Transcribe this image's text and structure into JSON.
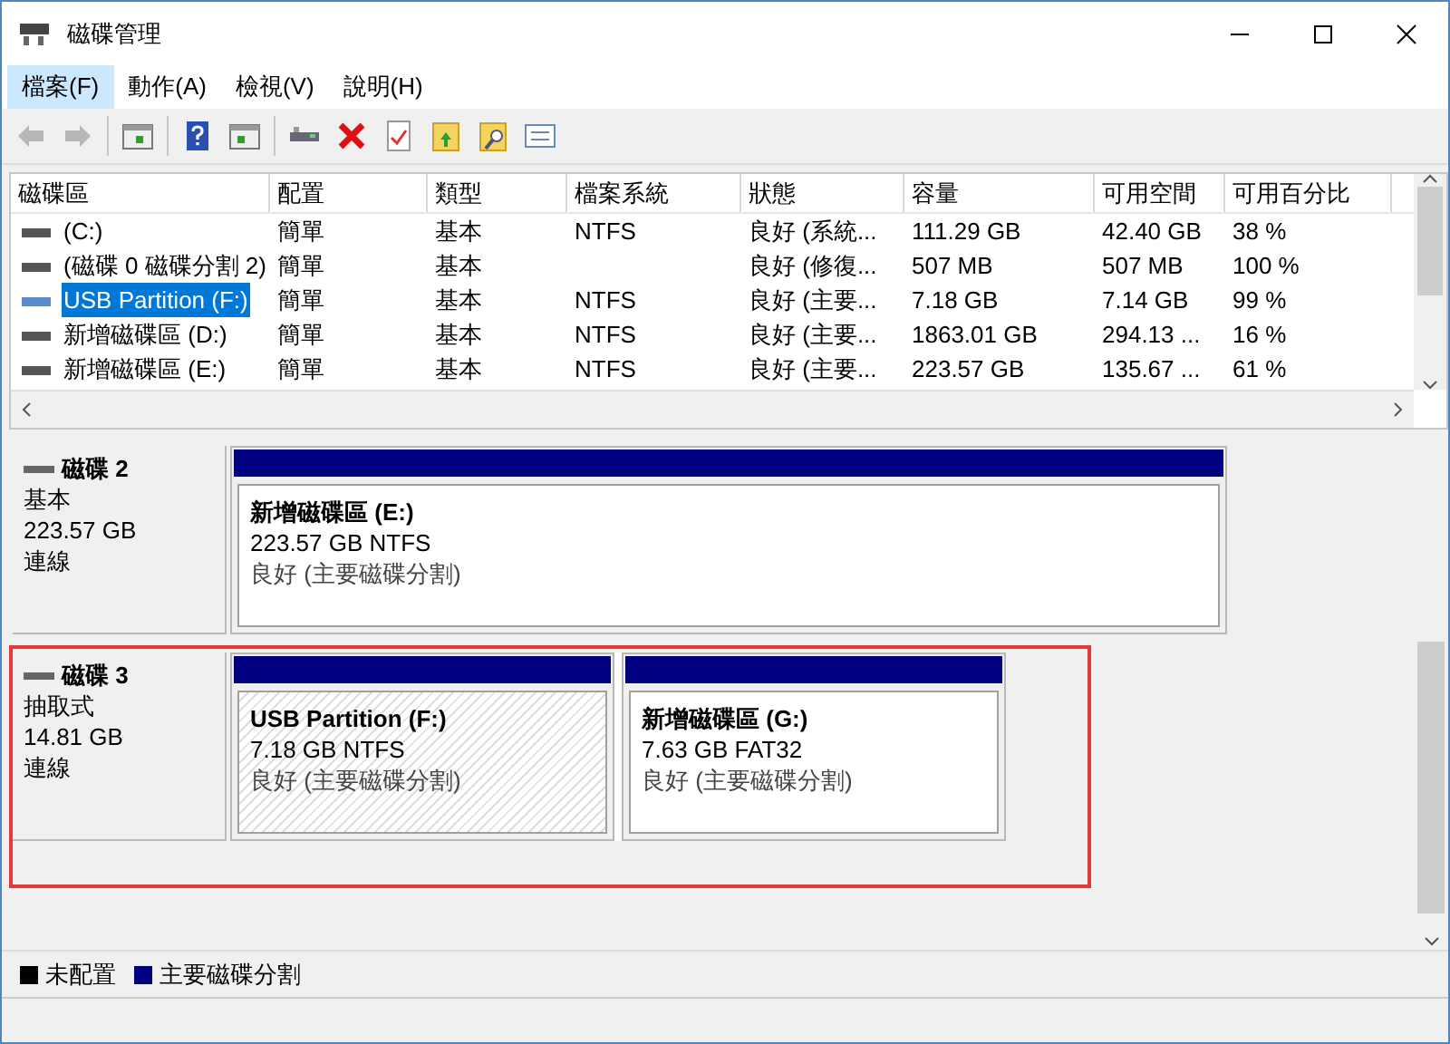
{
  "window": {
    "title": "磁碟管理"
  },
  "menu": [
    {
      "label": "檔案(F)",
      "selected": true
    },
    {
      "label": "動作(A)",
      "selected": false
    },
    {
      "label": "檢視(V)",
      "selected": false
    },
    {
      "label": "說明(H)",
      "selected": false
    }
  ],
  "toolbar": [
    {
      "kind": "back",
      "disabled": true
    },
    {
      "kind": "forward",
      "disabled": true
    },
    {
      "kind": "sep"
    },
    {
      "kind": "panel-left"
    },
    {
      "kind": "sep"
    },
    {
      "kind": "help"
    },
    {
      "kind": "panel-right"
    },
    {
      "kind": "sep"
    },
    {
      "kind": "drive"
    },
    {
      "kind": "delete"
    },
    {
      "kind": "check"
    },
    {
      "kind": "folder-up"
    },
    {
      "kind": "folder-search"
    },
    {
      "kind": "list"
    }
  ],
  "volumes": {
    "columns": [
      "磁碟區",
      "配置",
      "類型",
      "檔案系統",
      "狀態",
      "容量",
      "可用空間",
      "可用百分比"
    ],
    "rows": [
      {
        "selected": false,
        "cells": [
          "(C:)",
          "簡單",
          "基本",
          "NTFS",
          "良好 (系統...",
          "111.29 GB",
          "42.40 GB",
          "38 %"
        ]
      },
      {
        "selected": false,
        "cells": [
          "(磁碟 0 磁碟分割 2)",
          "簡單",
          "基本",
          "",
          "良好 (修復...",
          "507 MB",
          "507 MB",
          "100 %"
        ]
      },
      {
        "selected": true,
        "cells": [
          "USB Partition (F:)",
          "簡單",
          "基本",
          "NTFS",
          "良好 (主要...",
          "7.18 GB",
          "7.14 GB",
          "99 %"
        ]
      },
      {
        "selected": false,
        "cells": [
          "新增磁碟區 (D:)",
          "簡單",
          "基本",
          "NTFS",
          "良好 (主要...",
          "1863.01 GB",
          "294.13 ...",
          "16 %"
        ]
      },
      {
        "selected": false,
        "cells": [
          "新增磁碟區 (E:)",
          "簡單",
          "基本",
          "NTFS",
          "良好 (主要...",
          "223.57 GB",
          "135.67 ...",
          "61 %"
        ]
      }
    ]
  },
  "disks": [
    {
      "name": "磁碟 2",
      "type": "基本",
      "size": "223.57 GB",
      "status": "連線",
      "highlighted": false,
      "partitions": [
        {
          "name": "新增磁碟區  (E:)",
          "detail": "223.57 GB NTFS",
          "status": "良好 (主要磁碟分割)",
          "selected": false
        }
      ]
    },
    {
      "name": "磁碟 3",
      "type": "抽取式",
      "size": "14.81 GB",
      "status": "連線",
      "highlighted": true,
      "partitions": [
        {
          "name": "USB Partition  (F:)",
          "detail": "7.18 GB NTFS",
          "status": "良好 (主要磁碟分割)",
          "selected": true
        },
        {
          "name": "新增磁碟區  (G:)",
          "detail": "7.63 GB FAT32",
          "status": "良好 (主要磁碟分割)",
          "selected": false
        }
      ]
    }
  ],
  "legend": [
    {
      "label": "未配置",
      "color": "#000000"
    },
    {
      "label": "主要磁碟分割",
      "color": "#000080"
    }
  ]
}
